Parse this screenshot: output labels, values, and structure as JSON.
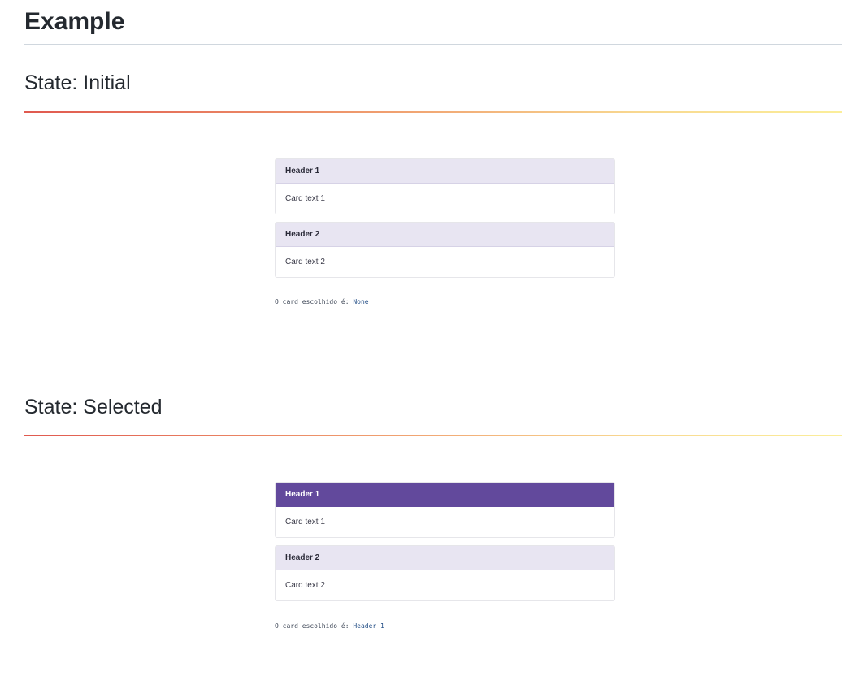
{
  "page": {
    "title": "Example"
  },
  "states": {
    "initial": {
      "heading": "State: Initial",
      "cards": [
        {
          "header": "Header 1",
          "text": "Card text 1",
          "selected": false
        },
        {
          "header": "Header 2",
          "text": "Card text 2",
          "selected": false
        }
      ],
      "result_label": "O card escolhido é: ",
      "result_value": "None"
    },
    "selected": {
      "heading": "State: Selected",
      "cards": [
        {
          "header": "Header 1",
          "text": "Card text 1",
          "selected": true
        },
        {
          "header": "Header 2",
          "text": "Card text 2",
          "selected": false
        }
      ],
      "result_label": "O card escolhido é: ",
      "result_value": "Header 1"
    }
  },
  "colors": {
    "selected_header_bg": "#62499c",
    "header_bg": "#e8e5f2",
    "rule_gradient_start": "#e0594f",
    "rule_gradient_end": "#fbee9a"
  }
}
